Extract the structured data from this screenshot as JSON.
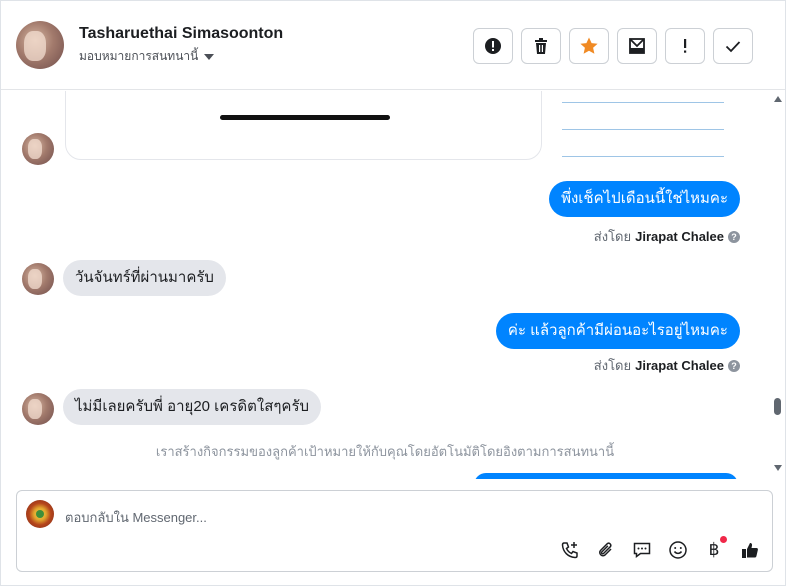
{
  "header": {
    "contact_name": "Tasharuethai Simasoonton",
    "assign_label": "มอบหมายการสนทนานี้",
    "tools": [
      "report-icon",
      "trash-icon",
      "star-icon",
      "archive-icon",
      "exclamation-icon",
      "check-icon"
    ]
  },
  "messages": [
    {
      "direction": "out",
      "text": "พึ่งเช็คไปเดือนนี้ใช่ไหมคะ",
      "sent_by_prefix": "ส่งโดย",
      "sender": "Jirapat Chalee"
    },
    {
      "direction": "in",
      "text": "วันจันทร์ที่ผ่านมาครับ"
    },
    {
      "direction": "out",
      "text": "ค่ะ แล้วลูกค้ามีผ่อนอะไรอยู่ไหมคะ",
      "sent_by_prefix": "ส่งโดย",
      "sender": "Jirapat Chalee"
    },
    {
      "direction": "in",
      "text": "ไม่มีเลยครับพี่ อายุ20 เครดิตใสๆครับ"
    }
  ],
  "system_note": "เราสร้างกิจกรรมของลูกค้าเป้าหมายให้กับคุณโดยอัตโนมัติโดยอิงตามการสนทนานี้",
  "composer": {
    "placeholder": "ตอบกลับใน Messenger...",
    "icons": [
      "add-call-icon",
      "attachment-icon",
      "saved-replies-icon",
      "emoji-icon",
      "payment-icon",
      "like-icon"
    ]
  },
  "colors": {
    "accent": "#0084ff",
    "incoming_bubble": "#e4e6eb",
    "star": "#f08a24",
    "notification_dot": "#f02849"
  }
}
